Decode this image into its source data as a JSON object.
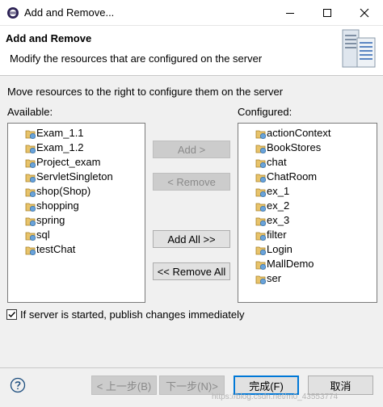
{
  "window": {
    "title": "Add and Remove...",
    "controls": [
      "minimize-icon",
      "maximize-icon",
      "close-icon"
    ]
  },
  "banner": {
    "title": "Add and Remove",
    "description": "Modify the resources that are configured on the server"
  },
  "instruction": "Move resources to the right to configure them on the server",
  "available": {
    "label": "Available:",
    "items": [
      "Exam_1.1",
      "Exam_1.2",
      "Project_exam",
      "ServletSingleton",
      "shop(Shop)",
      "shopping",
      "spring",
      "sql",
      "testChat"
    ]
  },
  "configured": {
    "label": "Configured:",
    "items": [
      "actionContext",
      "BookStores",
      "chat",
      "ChatRoom",
      "ex_1",
      "ex_2",
      "ex_3",
      "filter",
      "Login",
      "MallDemo",
      "ser"
    ]
  },
  "buttons": {
    "add": "Add >",
    "remove": "< Remove",
    "add_all": "Add All >>",
    "remove_all": "<< Remove All"
  },
  "publish_checkbox": {
    "label": "If server is started, publish changes immediately",
    "checked": true
  },
  "footer": {
    "back": "< 上一步(B)",
    "next": "下一步(N)>",
    "finish": "完成(F)",
    "cancel": "取消"
  },
  "watermark": "https://blog.csdn.net/m0_43553774",
  "colors": {
    "accent": "#0078d7",
    "disabled_text": "#8a8a8a",
    "panel_bg": "#f0f0f0",
    "list_bg": "#ffffff"
  }
}
